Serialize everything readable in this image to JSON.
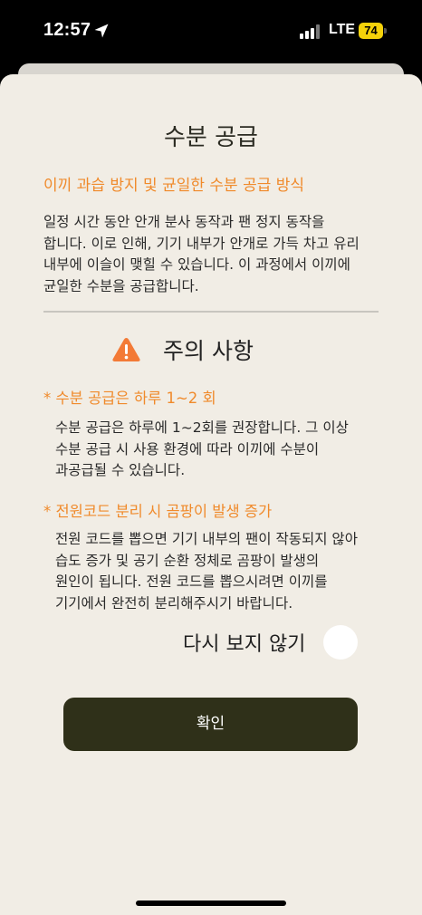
{
  "status_bar": {
    "time": "12:57",
    "network": "LTE",
    "battery": "74",
    "battery_color": "#f5d20a"
  },
  "sheet": {
    "title": "수분 공급",
    "subtitle": "이끼 과습 방지 및 균일한 수분 공급 방식",
    "intro_lines": [
      "일정 시간 동안 안개 분사 동작과 팬 정지 동작을",
      "합니다. 이로 인해, 기기 내부가 안개로 가득 차고 유리",
      "내부에 이슬이 맺힐 수 있습니다. 이 과정에서 이끼에",
      "균일한 수분을 공급합니다."
    ],
    "caution": {
      "icon": "warning-icon",
      "title": "주의 사항"
    },
    "notes": [
      {
        "title": "* 수분 공급은 하루 1~2 회",
        "lines": [
          "수분 공급은 하루에 1~2회를 권장합니다. 그 이상",
          "수분 공급 시 사용 환경에 따라 이끼에 수분이",
          "과공급될 수 있습니다."
        ]
      },
      {
        "title": "* 전원코드 분리 시 곰팡이 발생 증가",
        "lines": [
          "전원 코드를 뽑으면 기기 내부의 팬이 작동되지 않아",
          "습도 증가 및 공기 순환 정체로 곰팡이 발생의",
          "원인이 됩니다. 전원 코드를 뽑으시려면 이끼를",
          "기기에서 완전히 분리해주시기 바랍니다."
        ]
      }
    ],
    "dont_show_again_label": "다시 보지 않기",
    "confirm_label": "확인",
    "accent_color": "#f08a2b",
    "button_color": "#2f3019"
  }
}
